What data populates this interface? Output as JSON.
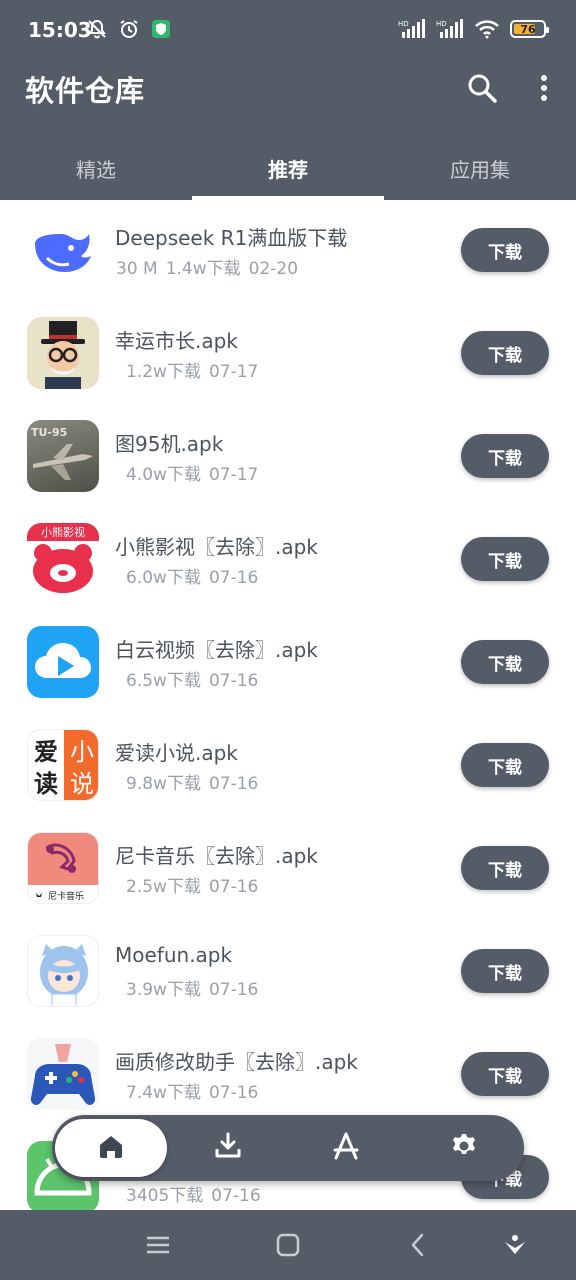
{
  "status_bar": {
    "time": "15:03",
    "left_icons": [
      "bell-off-icon",
      "alarm-icon",
      "shield-app-icon"
    ],
    "signal_labels": [
      "HD",
      "HD"
    ],
    "battery_level": "76",
    "battery_color": "#f2b233"
  },
  "app_bar": {
    "title": "软件仓库",
    "actions": [
      "search-icon",
      "more-vert-icon"
    ]
  },
  "tabs": [
    {
      "label": "精选",
      "active": false
    },
    {
      "label": "推荐",
      "active": true
    },
    {
      "label": "应用集",
      "active": false
    }
  ],
  "apps": [
    {
      "name": "Deepseek R1满血版下载",
      "size": "30 M",
      "downloads": "1.4w下载",
      "date": "02-20",
      "button": "下载",
      "icon": "deepseek-whale-icon"
    },
    {
      "name": "幸运市长.apk",
      "size": "",
      "downloads": "1.2w下载",
      "date": "07-17",
      "button": "下载",
      "icon": "mayor-avatar-icon"
    },
    {
      "name": "图95机.apk",
      "size": "",
      "downloads": "4.0w下载",
      "date": "07-17",
      "button": "下载",
      "icon": "tu95-plane-icon"
    },
    {
      "name": "小熊影视〖去除〗.apk",
      "size": "",
      "downloads": "6.0w下载",
      "date": "07-16",
      "button": "下载",
      "icon": "bear-video-icon"
    },
    {
      "name": "白云视频〖去除〗.apk",
      "size": "",
      "downloads": "6.5w下载",
      "date": "07-16",
      "button": "下载",
      "icon": "cloud-play-icon"
    },
    {
      "name": "爱读小说.apk",
      "size": "",
      "downloads": "9.8w下载",
      "date": "07-16",
      "button": "下载",
      "icon": "novel-reader-icon"
    },
    {
      "name": "尼卡音乐〖去除〗.apk",
      "size": "",
      "downloads": "2.5w下载",
      "date": "07-16",
      "button": "下载",
      "icon": "headphones-icon"
    },
    {
      "name": "Moefun.apk",
      "size": "",
      "downloads": "3.9w下载",
      "date": "07-16",
      "button": "下载",
      "icon": "anime-girl-icon"
    },
    {
      "name": "画质修改助手〖去除〗.apk",
      "size": "",
      "downloads": "7.4w下载",
      "date": "07-16",
      "button": "下载",
      "icon": "gamepad-icon"
    },
    {
      "name": "",
      "size": "",
      "downloads": "3405下载",
      "date": "07-16",
      "button": "下载",
      "icon": "android-icon"
    }
  ],
  "icon_texts": {
    "bear_label": "小熊影视",
    "novel_chars": [
      "爱",
      "小",
      "读",
      "说"
    ],
    "nika_label": "尼卡音乐",
    "plane_label": "TU-95"
  },
  "bottom_nav": [
    {
      "icon": "home-icon",
      "active": true
    },
    {
      "icon": "download-icon",
      "active": false
    },
    {
      "icon": "app-store-icon",
      "active": false
    },
    {
      "icon": "settings-icon",
      "active": false
    }
  ],
  "system_nav": [
    "menu-icon",
    "home-square-icon",
    "back-icon",
    "assistant-icon"
  ],
  "colors": {
    "primary": "#545c67",
    "text": "#4b535e",
    "meta": "#9aa0a8",
    "background": "#ffffff"
  }
}
